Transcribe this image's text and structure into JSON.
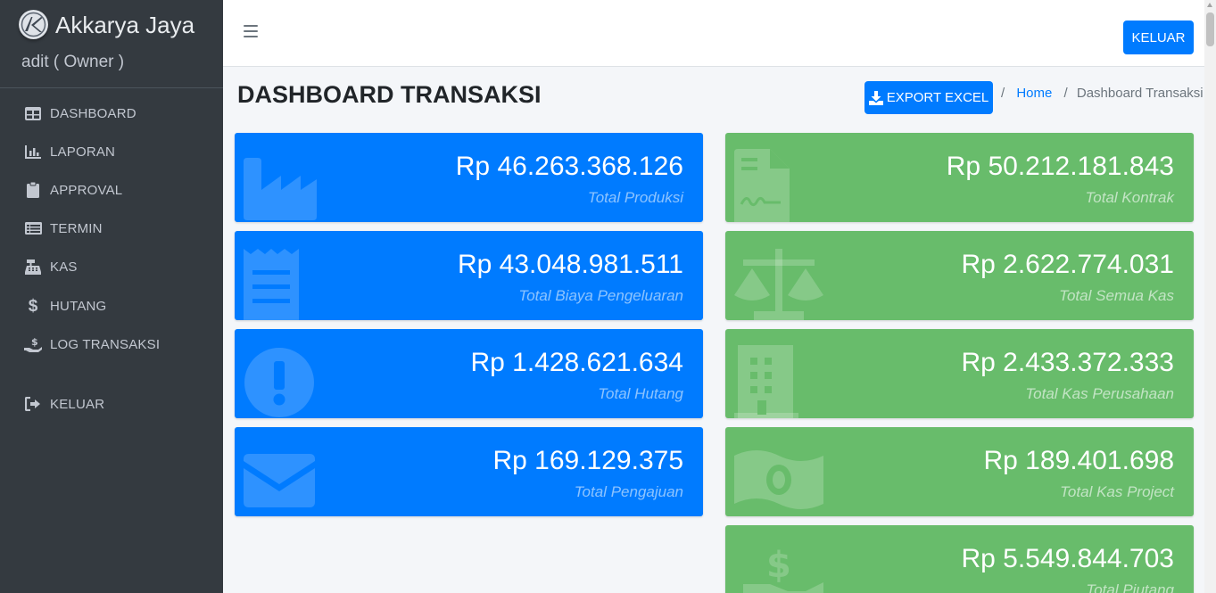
{
  "brand": {
    "name": "Akkarya Jaya",
    "user": "adit ( Owner )",
    "logo_icon": "ak-logo-icon"
  },
  "sidebar": {
    "items": [
      {
        "label": "DASHBOARD",
        "icon": "table-icon"
      },
      {
        "label": "LAPORAN",
        "icon": "chart-icon"
      },
      {
        "label": "APPROVAL",
        "icon": "clipboard-icon"
      },
      {
        "label": "TERMIN",
        "icon": "list-icon"
      },
      {
        "label": "KAS",
        "icon": "cash-register-icon"
      },
      {
        "label": "HUTANG",
        "icon": "dollar-icon"
      },
      {
        "label": "LOG TRANSAKSI",
        "icon": "hand-dollar-icon"
      },
      {
        "label": "KELUAR",
        "icon": "sign-out-icon"
      }
    ]
  },
  "topbar": {
    "logout_label": "KELUAR"
  },
  "header": {
    "title_bold": "DASHBOARD",
    "title_rest": " TRANSAKSI",
    "export_label": "EXPORT EXCEL",
    "breadcrumb": {
      "home": "Home",
      "current": "Dashboard Transaksi",
      "separator": "/"
    }
  },
  "cards_left": [
    {
      "value": "Rp 46.263.368.126",
      "label": "Total Produksi",
      "icon": "industry-icon"
    },
    {
      "value": "Rp 43.048.981.511",
      "label": "Total Biaya Pengeluaran",
      "icon": "receipt-icon"
    },
    {
      "value": "Rp 1.428.621.634",
      "label": "Total Hutang",
      "icon": "exclamation-circle-icon"
    },
    {
      "value": "Rp 169.129.375",
      "label": "Total Pengajuan",
      "icon": "envelope-icon"
    }
  ],
  "cards_right": [
    {
      "value": "Rp 50.212.181.843",
      "label": "Total Kontrak",
      "icon": "file-contract-icon"
    },
    {
      "value": "Rp 2.622.774.031",
      "label": "Total Semua Kas",
      "icon": "balance-scale-icon"
    },
    {
      "value": "Rp 2.433.372.333",
      "label": "Total Kas Perusahaan",
      "icon": "building-icon"
    },
    {
      "value": "Rp 189.401.698",
      "label": "Total Kas Project",
      "icon": "money-bill-icon"
    },
    {
      "value": "Rp 5.549.844.703",
      "label": "Total Piutang",
      "icon": "hand-holding-dollar-icon"
    }
  ],
  "colors": {
    "sidebar": "#343a40",
    "primary": "#007bff",
    "success": "#68bc6b"
  }
}
